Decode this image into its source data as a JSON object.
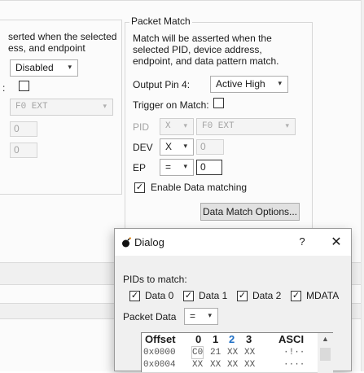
{
  "background_panel": {
    "left_group": {
      "desc": "serted when the selected\ness, and endpoint",
      "output_combo_value": "Disabled",
      "trigger_label_tail": ":",
      "pid_combo_value": "F0 EXT",
      "dev_value": "0",
      "ep_value": "0"
    },
    "packet_match": {
      "title": "Packet Match",
      "desc": "Match will be asserted when the selected PID, device address, endpoint, and data pattern match.",
      "output_pin_label": "Output Pin 4:",
      "output_pin_value": "Active High",
      "trigger_label": "Trigger on Match:",
      "pid_label": "PID",
      "pid_x_value": "X",
      "pid_value": "F0 EXT",
      "dev_label": "DEV",
      "dev_x_value": "X",
      "dev_value": "0",
      "ep_label": "EP",
      "ep_op_value": "=",
      "ep_value": "0",
      "enable_data_label": "Enable Data matching",
      "data_match_button": "Data Match Options..."
    }
  },
  "dialog": {
    "title": "Dialog",
    "help": "?",
    "close": "✕",
    "pids_label": "PIDs to match:",
    "pids": [
      "Data 0",
      "Data 1",
      "Data 2",
      "MDATA"
    ],
    "packet_data_label": "Packet Data",
    "packet_data_op": "=",
    "grid": {
      "headers": [
        "Offset",
        "0",
        "1",
        "2",
        "3",
        "ASCI"
      ],
      "rows": [
        {
          "offset": "0x0000",
          "b0": "C0",
          "b1": "21",
          "b2": "XX",
          "b3": "XX",
          "ascii": "·!··"
        },
        {
          "offset": "0x0004",
          "b0": "XX",
          "b1": "XX",
          "b2": "XX",
          "b3": "XX",
          "ascii": "····"
        }
      ]
    }
  },
  "colors": {
    "accent_header": "#1f6fc5",
    "dialog_bg": "#f0f0f0"
  }
}
